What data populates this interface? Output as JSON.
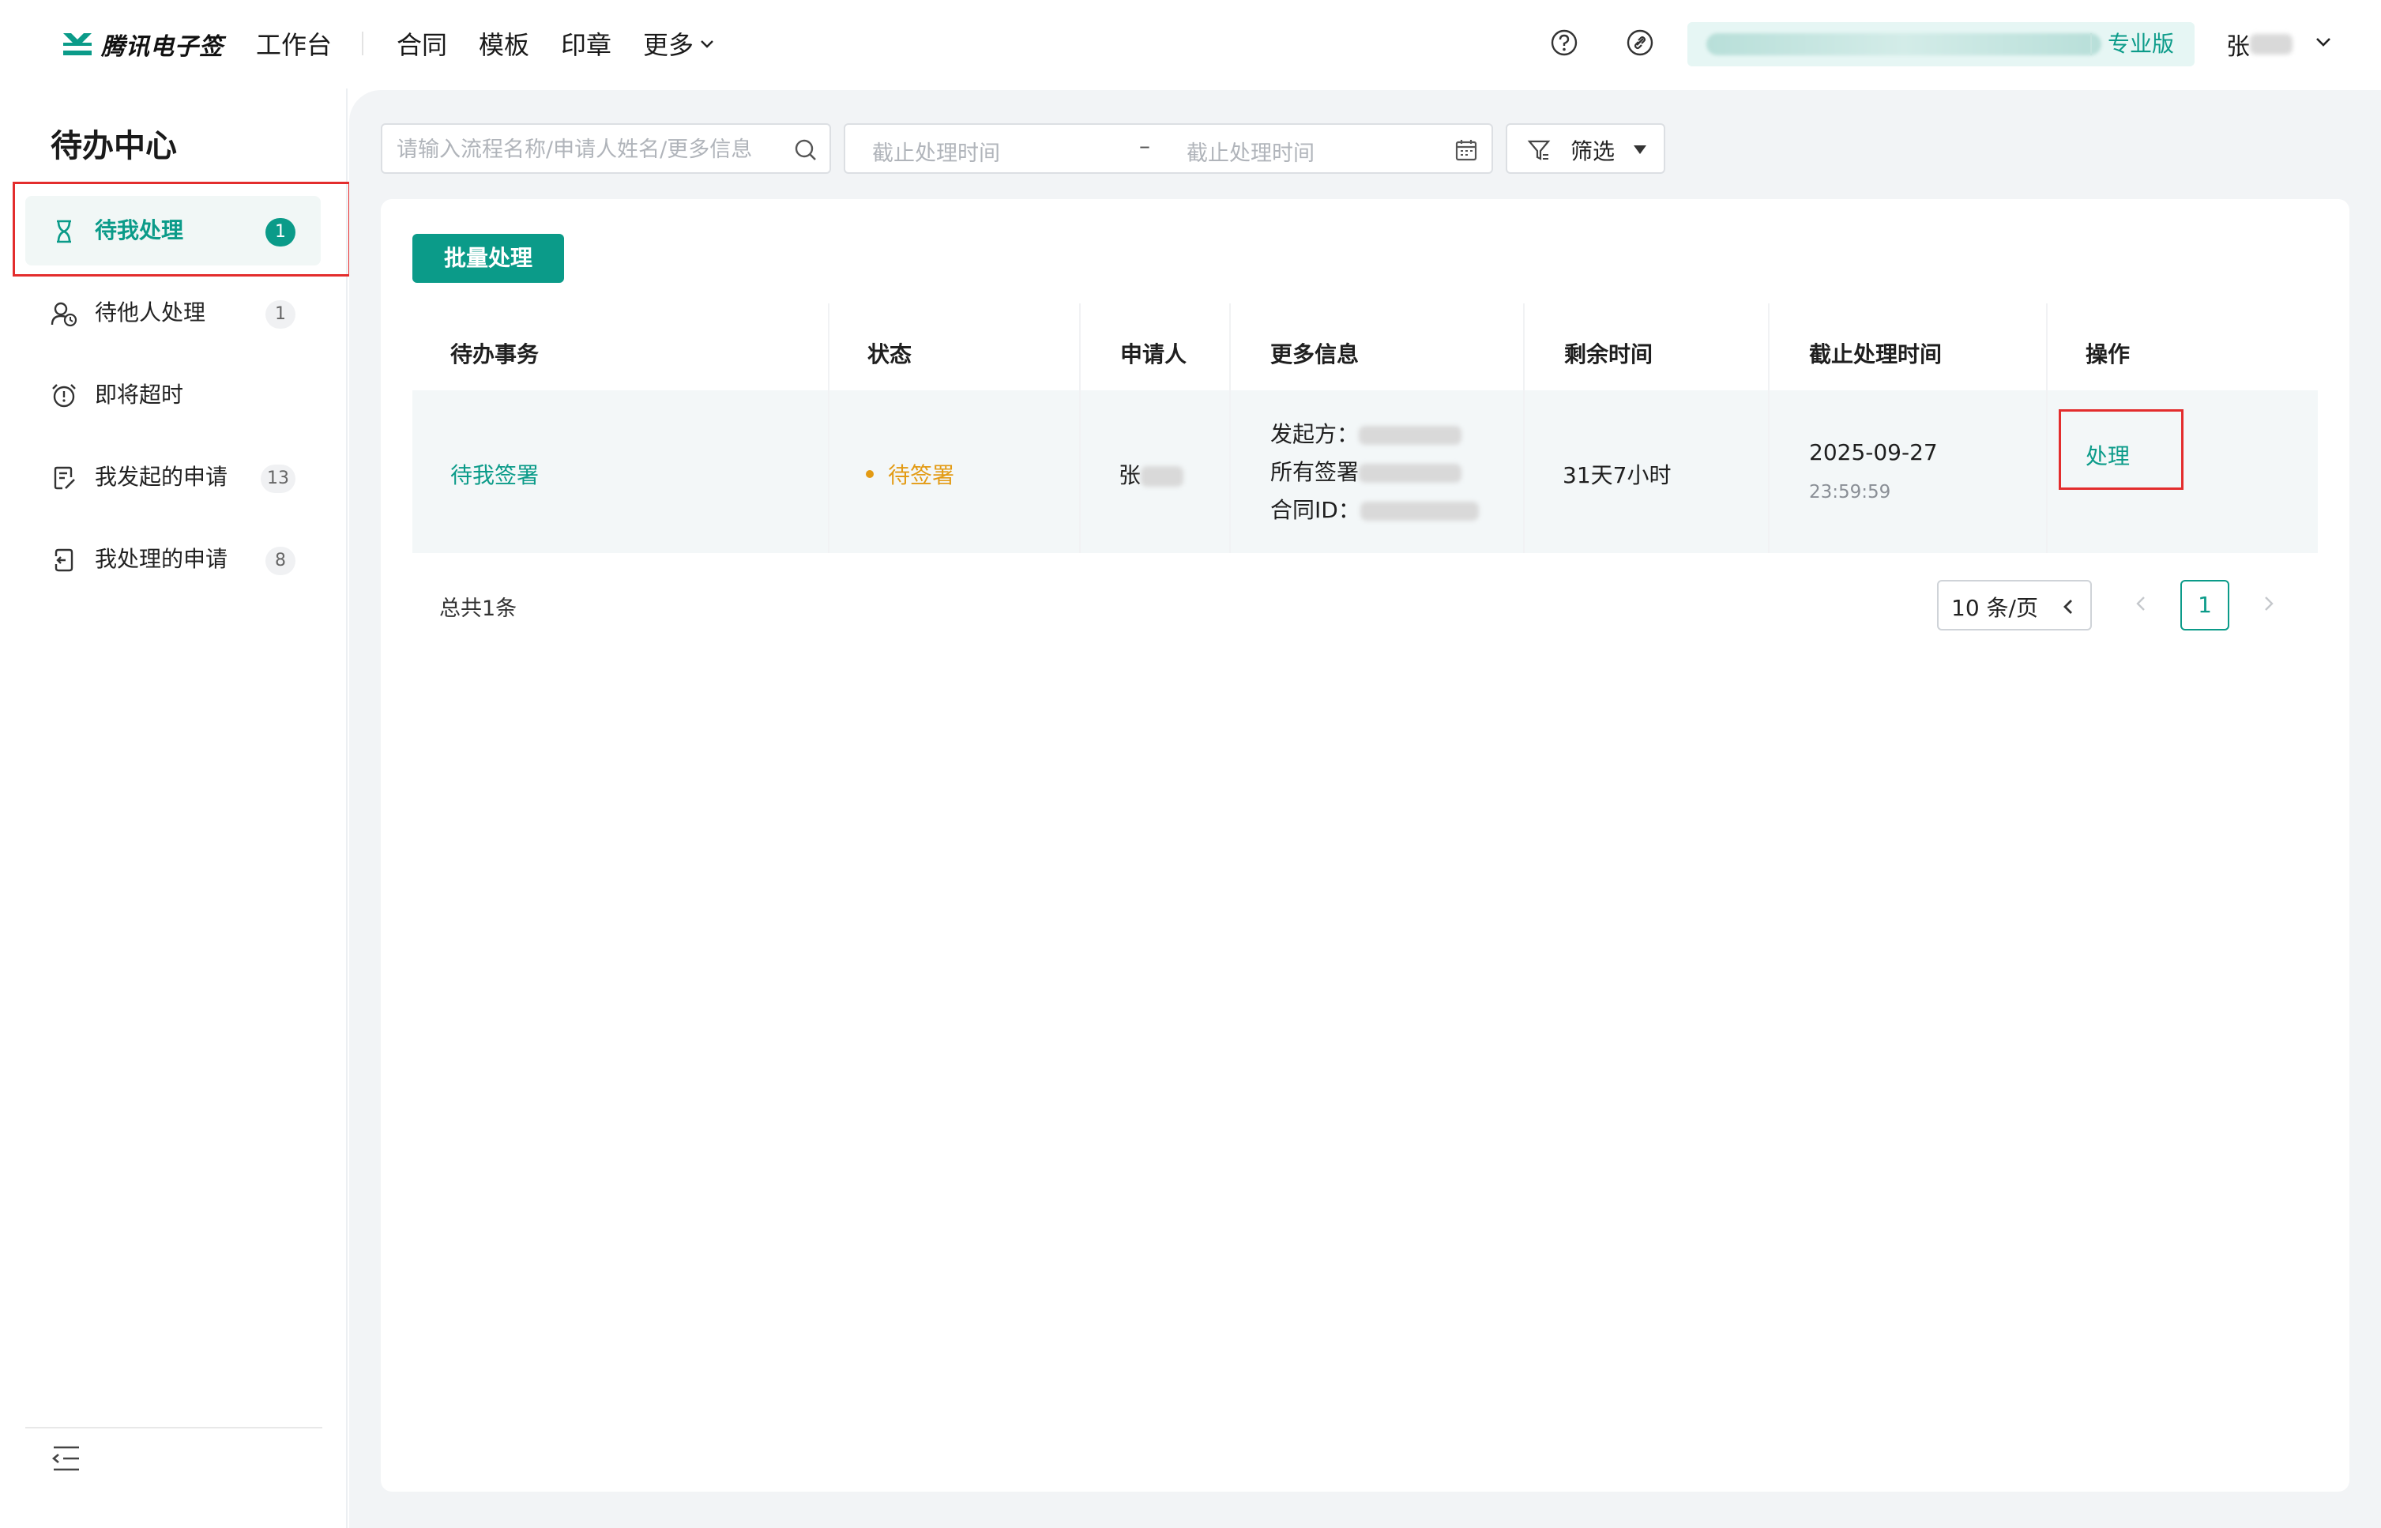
{
  "header": {
    "brand": "腾讯电子签",
    "nav": [
      "工作台",
      "合同",
      "模板",
      "印章",
      "更多"
    ],
    "icons": [
      "help-icon",
      "link-icon"
    ],
    "org_name": "██████████████████",
    "edition": "专业版",
    "user_name": "张"
  },
  "sidebar": {
    "title": "待办中心",
    "items": [
      {
        "label": "待我处理",
        "badge": "1",
        "icon": "hourglass-icon",
        "active": true
      },
      {
        "label": "待他人处理",
        "badge": "1",
        "icon": "user-clock-icon"
      },
      {
        "label": "即将超时",
        "badge": "",
        "icon": "alarm-clock-icon"
      },
      {
        "label": "我发起的申请",
        "badge": "13",
        "icon": "doc-edit-icon"
      },
      {
        "label": "我处理的申请",
        "badge": "8",
        "icon": "doc-return-icon"
      }
    ]
  },
  "toolbar": {
    "search_placeholder": "请输入流程名称/申请人姓名/更多信息",
    "date_start_placeholder": "截止处理时间",
    "date_separator": "–",
    "date_end_placeholder": "截止处理时间",
    "filter_label": "筛选",
    "batch_label": "批量处理"
  },
  "table": {
    "columns": [
      "待办事务",
      "状态",
      "申请人",
      "更多信息",
      "剩余时间",
      "截止处理时间",
      "操作"
    ],
    "rows": [
      {
        "task": "待我签署",
        "status": "待签署",
        "applicant": "张",
        "info": [
          "发起方：",
          "所有签署",
          "合同ID："
        ],
        "remaining": "31天7小时",
        "deadline_date": "2025-09-27",
        "deadline_time": "23:59:59",
        "action": "处理"
      }
    ]
  },
  "pagination": {
    "total": "总共1条",
    "page_size": "10 条/页",
    "current_page": "1"
  },
  "colors": {
    "accent": "#0b9b89",
    "status_pending": "#e39b14",
    "highlight_box": "#e32d2d"
  }
}
